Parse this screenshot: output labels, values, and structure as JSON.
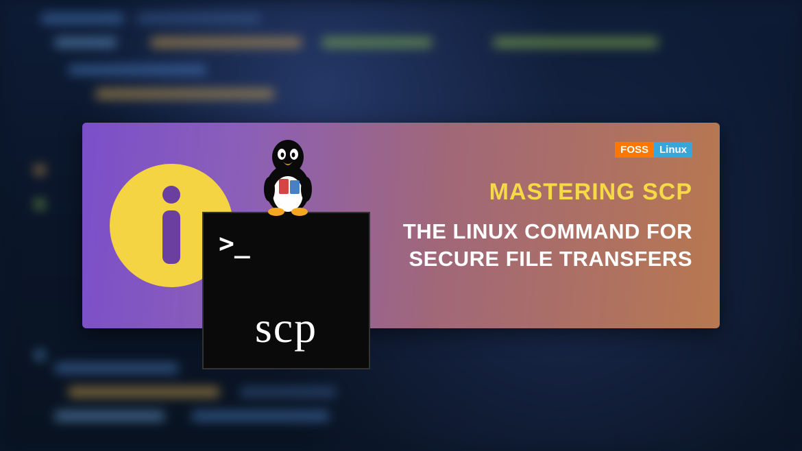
{
  "logo": {
    "left": "FOSS",
    "right": "Linux"
  },
  "headline": {
    "title": "MASTERING SCP",
    "subtitle_line1": "THE LINUX COMMAND FOR",
    "subtitle_line2": "SECURE FILE TRANSFERS"
  },
  "terminal": {
    "prompt": ">_",
    "command": "scp"
  },
  "icon": {
    "info_semantic": "info-icon",
    "penguin_semantic": "tux-penguin-icon",
    "terminal_semantic": "terminal-icon"
  },
  "colors": {
    "accent_yellow": "#f5d947",
    "gradient_from": "#7b4fc9",
    "gradient_to": "#b87850",
    "logo_orange": "#ff7700",
    "logo_blue": "#3aa5d8"
  }
}
